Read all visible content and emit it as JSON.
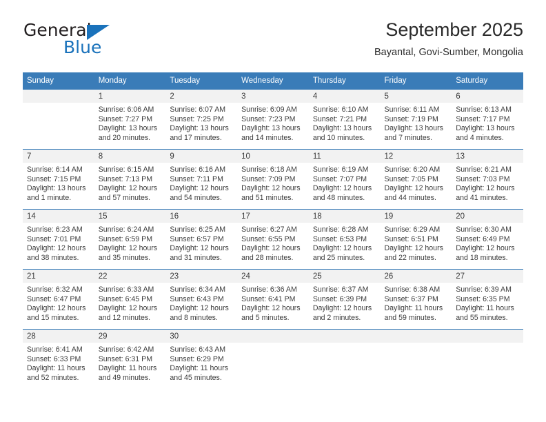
{
  "logo": {
    "word_one": "General",
    "word_two": "Blue",
    "triangle_icon": "triangle-icon",
    "colors": {
      "dark": "#231f20",
      "blue": "#1a72bb"
    }
  },
  "header": {
    "title": "September 2025",
    "subtitle": "Bayantal, Govi-Sumber, Mongolia"
  },
  "theme": {
    "header_bg": "#3a7cb8",
    "daynum_bg": "#f2f2f2",
    "text": "#3b3b3b",
    "page_bg": "#ffffff"
  },
  "calendar": {
    "weekday_headers": [
      "Sunday",
      "Monday",
      "Tuesday",
      "Wednesday",
      "Thursday",
      "Friday",
      "Saturday"
    ],
    "weeks": [
      [
        {
          "day": "",
          "lines": []
        },
        {
          "day": "1",
          "lines": [
            "Sunrise: 6:06 AM",
            "Sunset: 7:27 PM",
            "Daylight: 13 hours",
            "and 20 minutes."
          ]
        },
        {
          "day": "2",
          "lines": [
            "Sunrise: 6:07 AM",
            "Sunset: 7:25 PM",
            "Daylight: 13 hours",
            "and 17 minutes."
          ]
        },
        {
          "day": "3",
          "lines": [
            "Sunrise: 6:09 AM",
            "Sunset: 7:23 PM",
            "Daylight: 13 hours",
            "and 14 minutes."
          ]
        },
        {
          "day": "4",
          "lines": [
            "Sunrise: 6:10 AM",
            "Sunset: 7:21 PM",
            "Daylight: 13 hours",
            "and 10 minutes."
          ]
        },
        {
          "day": "5",
          "lines": [
            "Sunrise: 6:11 AM",
            "Sunset: 7:19 PM",
            "Daylight: 13 hours",
            "and 7 minutes."
          ]
        },
        {
          "day": "6",
          "lines": [
            "Sunrise: 6:13 AM",
            "Sunset: 7:17 PM",
            "Daylight: 13 hours",
            "and 4 minutes."
          ]
        }
      ],
      [
        {
          "day": "7",
          "lines": [
            "Sunrise: 6:14 AM",
            "Sunset: 7:15 PM",
            "Daylight: 13 hours",
            "and 1 minute."
          ]
        },
        {
          "day": "8",
          "lines": [
            "Sunrise: 6:15 AM",
            "Sunset: 7:13 PM",
            "Daylight: 12 hours",
            "and 57 minutes."
          ]
        },
        {
          "day": "9",
          "lines": [
            "Sunrise: 6:16 AM",
            "Sunset: 7:11 PM",
            "Daylight: 12 hours",
            "and 54 minutes."
          ]
        },
        {
          "day": "10",
          "lines": [
            "Sunrise: 6:18 AM",
            "Sunset: 7:09 PM",
            "Daylight: 12 hours",
            "and 51 minutes."
          ]
        },
        {
          "day": "11",
          "lines": [
            "Sunrise: 6:19 AM",
            "Sunset: 7:07 PM",
            "Daylight: 12 hours",
            "and 48 minutes."
          ]
        },
        {
          "day": "12",
          "lines": [
            "Sunrise: 6:20 AM",
            "Sunset: 7:05 PM",
            "Daylight: 12 hours",
            "and 44 minutes."
          ]
        },
        {
          "day": "13",
          "lines": [
            "Sunrise: 6:21 AM",
            "Sunset: 7:03 PM",
            "Daylight: 12 hours",
            "and 41 minutes."
          ]
        }
      ],
      [
        {
          "day": "14",
          "lines": [
            "Sunrise: 6:23 AM",
            "Sunset: 7:01 PM",
            "Daylight: 12 hours",
            "and 38 minutes."
          ]
        },
        {
          "day": "15",
          "lines": [
            "Sunrise: 6:24 AM",
            "Sunset: 6:59 PM",
            "Daylight: 12 hours",
            "and 35 minutes."
          ]
        },
        {
          "day": "16",
          "lines": [
            "Sunrise: 6:25 AM",
            "Sunset: 6:57 PM",
            "Daylight: 12 hours",
            "and 31 minutes."
          ]
        },
        {
          "day": "17",
          "lines": [
            "Sunrise: 6:27 AM",
            "Sunset: 6:55 PM",
            "Daylight: 12 hours",
            "and 28 minutes."
          ]
        },
        {
          "day": "18",
          "lines": [
            "Sunrise: 6:28 AM",
            "Sunset: 6:53 PM",
            "Daylight: 12 hours",
            "and 25 minutes."
          ]
        },
        {
          "day": "19",
          "lines": [
            "Sunrise: 6:29 AM",
            "Sunset: 6:51 PM",
            "Daylight: 12 hours",
            "and 22 minutes."
          ]
        },
        {
          "day": "20",
          "lines": [
            "Sunrise: 6:30 AM",
            "Sunset: 6:49 PM",
            "Daylight: 12 hours",
            "and 18 minutes."
          ]
        }
      ],
      [
        {
          "day": "21",
          "lines": [
            "Sunrise: 6:32 AM",
            "Sunset: 6:47 PM",
            "Daylight: 12 hours",
            "and 15 minutes."
          ]
        },
        {
          "day": "22",
          "lines": [
            "Sunrise: 6:33 AM",
            "Sunset: 6:45 PM",
            "Daylight: 12 hours",
            "and 12 minutes."
          ]
        },
        {
          "day": "23",
          "lines": [
            "Sunrise: 6:34 AM",
            "Sunset: 6:43 PM",
            "Daylight: 12 hours",
            "and 8 minutes."
          ]
        },
        {
          "day": "24",
          "lines": [
            "Sunrise: 6:36 AM",
            "Sunset: 6:41 PM",
            "Daylight: 12 hours",
            "and 5 minutes."
          ]
        },
        {
          "day": "25",
          "lines": [
            "Sunrise: 6:37 AM",
            "Sunset: 6:39 PM",
            "Daylight: 12 hours",
            "and 2 minutes."
          ]
        },
        {
          "day": "26",
          "lines": [
            "Sunrise: 6:38 AM",
            "Sunset: 6:37 PM",
            "Daylight: 11 hours",
            "and 59 minutes."
          ]
        },
        {
          "day": "27",
          "lines": [
            "Sunrise: 6:39 AM",
            "Sunset: 6:35 PM",
            "Daylight: 11 hours",
            "and 55 minutes."
          ]
        }
      ],
      [
        {
          "day": "28",
          "lines": [
            "Sunrise: 6:41 AM",
            "Sunset: 6:33 PM",
            "Daylight: 11 hours",
            "and 52 minutes."
          ]
        },
        {
          "day": "29",
          "lines": [
            "Sunrise: 6:42 AM",
            "Sunset: 6:31 PM",
            "Daylight: 11 hours",
            "and 49 minutes."
          ]
        },
        {
          "day": "30",
          "lines": [
            "Sunrise: 6:43 AM",
            "Sunset: 6:29 PM",
            "Daylight: 11 hours",
            "and 45 minutes."
          ]
        },
        {
          "day": "",
          "lines": []
        },
        {
          "day": "",
          "lines": []
        },
        {
          "day": "",
          "lines": []
        },
        {
          "day": "",
          "lines": []
        }
      ]
    ]
  }
}
